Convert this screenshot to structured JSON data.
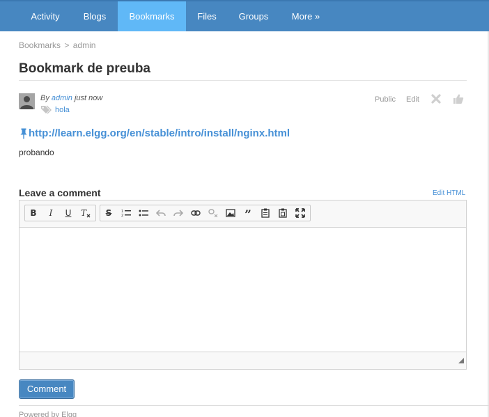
{
  "nav": {
    "items": [
      {
        "label": "Activity",
        "active": false
      },
      {
        "label": "Blogs",
        "active": false
      },
      {
        "label": "Bookmarks",
        "active": true
      },
      {
        "label": "Files",
        "active": false
      },
      {
        "label": "Groups",
        "active": false
      },
      {
        "label": "More »",
        "active": false
      }
    ]
  },
  "breadcrumb": {
    "section": "Bookmarks",
    "separator": ">",
    "owner": "admin"
  },
  "bookmark": {
    "title": "Bookmark de preuba",
    "by_prefix": "By",
    "author": "admin",
    "time": "just now",
    "tags": [
      "hola"
    ],
    "access": "Public",
    "edit_label": "Edit",
    "url": "http://learn.elgg.org/en/stable/intro/install/nginx.html",
    "description": "probando"
  },
  "comment": {
    "heading": "Leave a comment",
    "edit_html_label": "Edit HTML",
    "body_value": "",
    "toolbar": [
      "bold-icon",
      "italic-icon",
      "underline-icon",
      "remove-format-icon",
      "strikethrough-icon",
      "numbered-list-icon",
      "bulleted-list-icon",
      "undo-icon",
      "redo-icon",
      "link-icon",
      "unlink-icon",
      "image-icon",
      "blockquote-icon",
      "paste-text-icon",
      "paste-word-icon",
      "maximize-icon"
    ],
    "submit_label": "Comment"
  },
  "footer": {
    "prefix": "Powered by",
    "link": "Elgg"
  },
  "colors": {
    "navbar": "#4787c1",
    "nav_active": "#60b8f7",
    "link": "#4690d6"
  }
}
